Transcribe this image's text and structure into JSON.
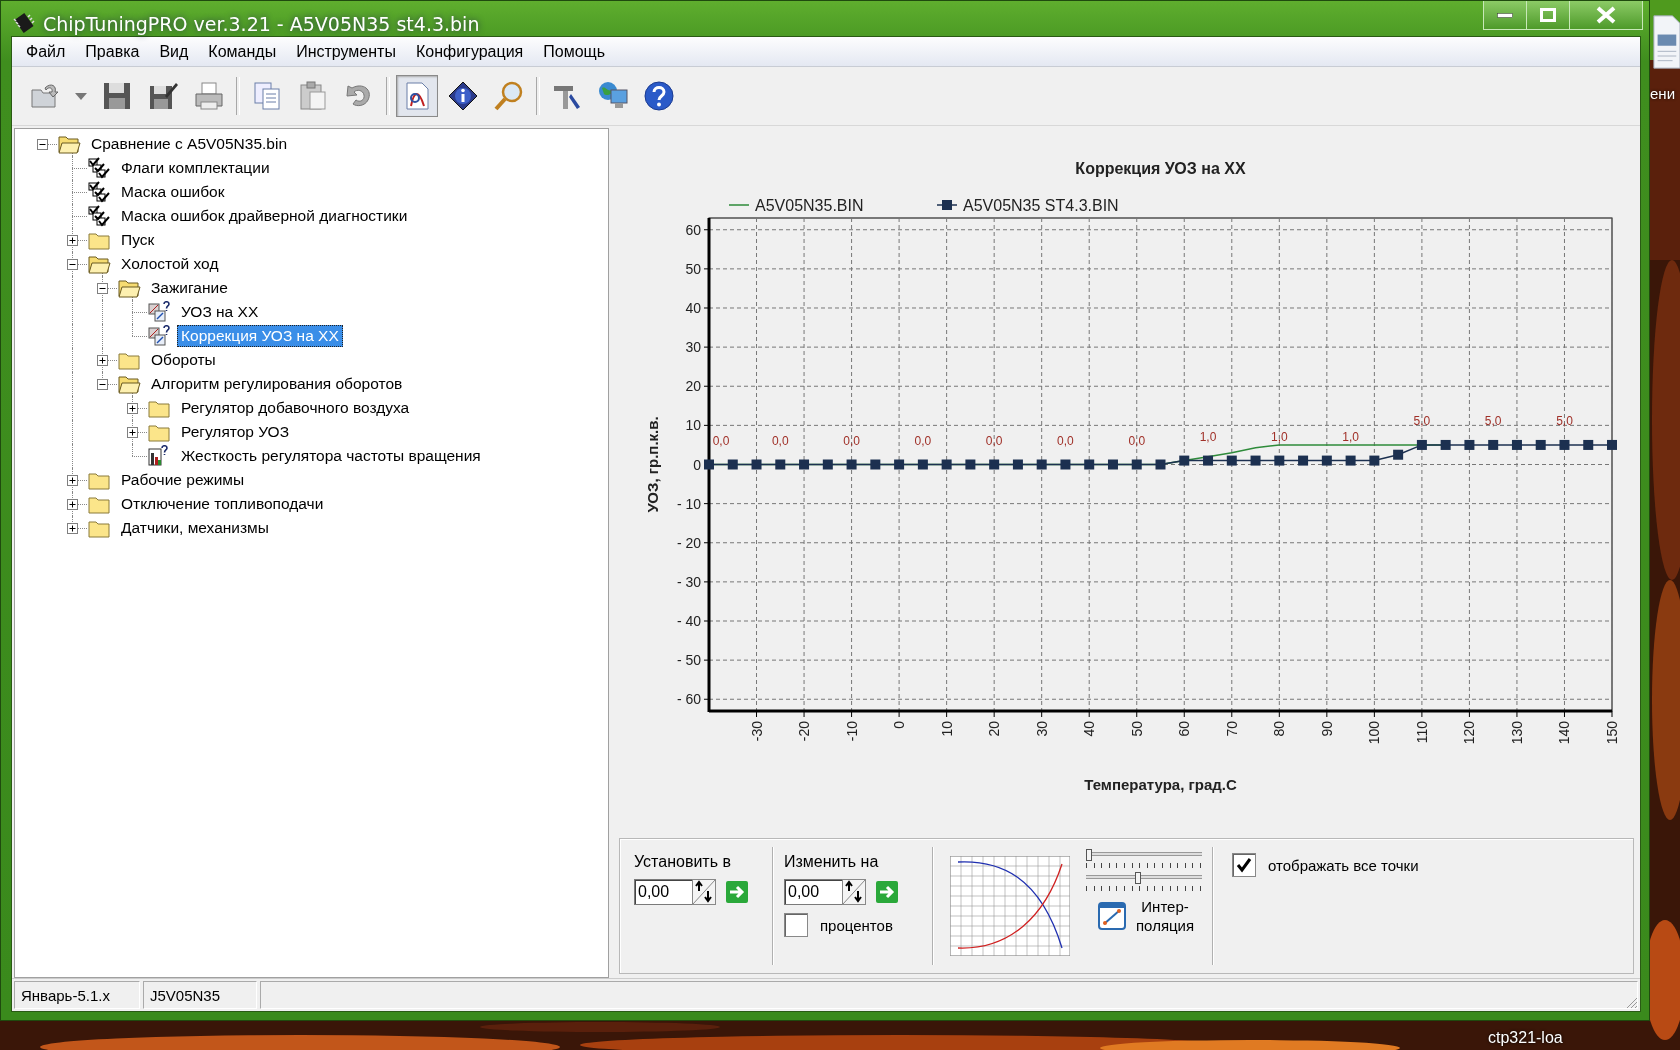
{
  "window": {
    "title": "ChipTuningPRO ver.3.21 - A5V05N35 st4.3.bin"
  },
  "menu": [
    "Файл",
    "Правка",
    "Вид",
    "Команды",
    "Инструменты",
    "Конфигурация",
    "Помощь"
  ],
  "toolbar": [
    {
      "kind": "open",
      "pressed": false
    },
    {
      "kind": "dropdown",
      "pressed": false
    },
    {
      "kind": "save",
      "pressed": false
    },
    {
      "kind": "save-as",
      "pressed": false
    },
    {
      "kind": "print",
      "pressed": false
    },
    {
      "kind": "separator"
    },
    {
      "kind": "copy",
      "pressed": false
    },
    {
      "kind": "paste",
      "pressed": false
    },
    {
      "kind": "undo",
      "pressed": false
    },
    {
      "kind": "separator"
    },
    {
      "kind": "chart-doc",
      "pressed": true
    },
    {
      "kind": "info",
      "pressed": false
    },
    {
      "kind": "search",
      "pressed": false
    },
    {
      "kind": "separator"
    },
    {
      "kind": "tools",
      "pressed": false
    },
    {
      "kind": "network",
      "pressed": false
    },
    {
      "kind": "help",
      "pressed": false
    }
  ],
  "tree": [
    {
      "label": "Сравнение с A5V05N35.bin",
      "kind": "folder-open",
      "expanded": true,
      "selected": false,
      "children": [
        {
          "label": "Флаги комплектации",
          "kind": "checklist",
          "selected": false
        },
        {
          "label": "Маска ошибок",
          "kind": "checklist",
          "selected": false
        },
        {
          "label": "Маска ошибок драйверной диагностики",
          "kind": "checklist",
          "selected": false
        },
        {
          "label": "Пуск",
          "kind": "folder",
          "expanded": false,
          "selected": false
        },
        {
          "label": "Холостой ход",
          "kind": "folder-open",
          "expanded": true,
          "selected": false,
          "children": [
            {
              "label": "Зажигание",
              "kind": "folder-open",
              "expanded": true,
              "selected": false,
              "children": [
                {
                  "label": "УОЗ на XX",
                  "kind": "map",
                  "selected": false
                },
                {
                  "label": "Коррекция УОЗ на XX",
                  "kind": "map",
                  "selected": true
                }
              ]
            },
            {
              "label": "Обороты",
              "kind": "folder",
              "expanded": false,
              "selected": false
            },
            {
              "label": "Алгоритм регулирования оборотов",
              "kind": "folder-open",
              "expanded": true,
              "selected": false,
              "children": [
                {
                  "label": "Регулятор добавочного воздуха",
                  "kind": "folder",
                  "expanded": false,
                  "selected": false
                },
                {
                  "label": "Регулятор УОЗ",
                  "kind": "folder",
                  "expanded": false,
                  "selected": false
                },
                {
                  "label": "Жесткость регулятора частоты вращения",
                  "kind": "chart",
                  "selected": false
                }
              ]
            }
          ]
        },
        {
          "label": "Рабочие режимы",
          "kind": "folder",
          "expanded": false,
          "selected": false
        },
        {
          "label": "Отключение топливоподачи",
          "kind": "folder",
          "expanded": false,
          "selected": false
        },
        {
          "label": "Датчики, механизмы",
          "kind": "folder",
          "expanded": false,
          "selected": false
        }
      ]
    }
  ],
  "chart": {
    "chart_data": {
      "type": "line",
      "title": "Коррекция УОЗ на XX",
      "xlabel": "Температура, град.С",
      "ylabel": "УОЗ, гр.п.к.в.",
      "grid": true,
      "legend": true,
      "x": [
        -40,
        -35,
        -30,
        -25,
        -20,
        -15,
        -10,
        -5,
        0,
        5,
        10,
        15,
        20,
        25,
        30,
        35,
        40,
        45,
        50,
        55,
        60,
        65,
        70,
        75,
        80,
        85,
        90,
        95,
        100,
        105,
        110,
        115,
        120,
        125,
        130,
        135,
        140,
        145,
        150
      ],
      "series": [
        {
          "name": "A5V05N35.BIN",
          "color": "#2e8b3a",
          "values": [
            0,
            0,
            0,
            0,
            0,
            0,
            0,
            0,
            0,
            0,
            0,
            0,
            0,
            0,
            0,
            0,
            0,
            0,
            0,
            0,
            1,
            2,
            3,
            4.3,
            5,
            5,
            5,
            5,
            5,
            5,
            5,
            5,
            null,
            null,
            null,
            null,
            null,
            null,
            null
          ]
        },
        {
          "name": "A5V05N35 ST4.3.BIN",
          "color": "#1c3050",
          "marker": "square",
          "values": [
            0,
            0,
            0,
            0,
            0,
            0,
            0,
            0,
            0,
            0,
            0,
            0,
            0,
            0,
            0,
            0,
            0,
            0,
            0,
            0,
            1,
            1,
            1,
            1,
            1,
            1,
            1,
            1,
            1,
            2.5,
            5,
            5,
            5,
            5,
            5,
            5,
            5,
            5,
            5
          ],
          "value_labels": [
            "0,0",
            null,
            null,
            "0,0",
            null,
            null,
            "0,0",
            null,
            null,
            "0,0",
            null,
            null,
            "0,0",
            null,
            null,
            "0,0",
            null,
            null,
            "0,0",
            null,
            null,
            "1,0",
            null,
            null,
            "1,0",
            null,
            null,
            "1,0",
            null,
            null,
            "5,0",
            null,
            null,
            "5,0",
            null,
            null,
            "5,0",
            null,
            null
          ]
        }
      ],
      "xlim": [
        -40,
        150
      ],
      "ylim": [
        -63,
        63
      ],
      "xticks": [
        -30,
        -20,
        -10,
        0,
        10,
        20,
        30,
        40,
        50,
        60,
        70,
        80,
        90,
        100,
        110,
        120,
        130,
        140,
        150
      ],
      "yticks": [
        {
          "value": 60,
          "label": "60"
        },
        {
          "value": 50,
          "label": "50"
        },
        {
          "value": 40,
          "label": "40"
        },
        {
          "value": 30,
          "label": "30"
        },
        {
          "value": 20,
          "label": "20"
        },
        {
          "value": 10,
          "label": "10"
        },
        {
          "value": 0,
          "label": "0"
        },
        {
          "value": -10,
          "label": "- 10"
        },
        {
          "value": -20,
          "label": "- 20"
        },
        {
          "value": -30,
          "label": "- 30"
        },
        {
          "value": -40,
          "label": "- 40"
        },
        {
          "value": -50,
          "label": "- 50"
        },
        {
          "value": -60,
          "label": "- 60"
        }
      ]
    }
  },
  "controls": {
    "set_to": {
      "label": "Установить в",
      "value": "0,00"
    },
    "change_by": {
      "label": "Изменить на",
      "value": "0,00",
      "percent": {
        "label": "процентов",
        "checked": false
      }
    },
    "sliders": [
      {
        "level": 0.03
      },
      {
        "level": 0.45
      }
    ],
    "interpolation": {
      "lines": [
        "Интер-",
        "поляция"
      ]
    },
    "show_all_points": {
      "label": "отображать все точки",
      "checked": true
    }
  },
  "status_bar": [
    "Январь-5.1.x",
    "J5V05N35"
  ],
  "desktop": {
    "icon_label": "ени",
    "bottom_label": "ctp321-loa"
  }
}
